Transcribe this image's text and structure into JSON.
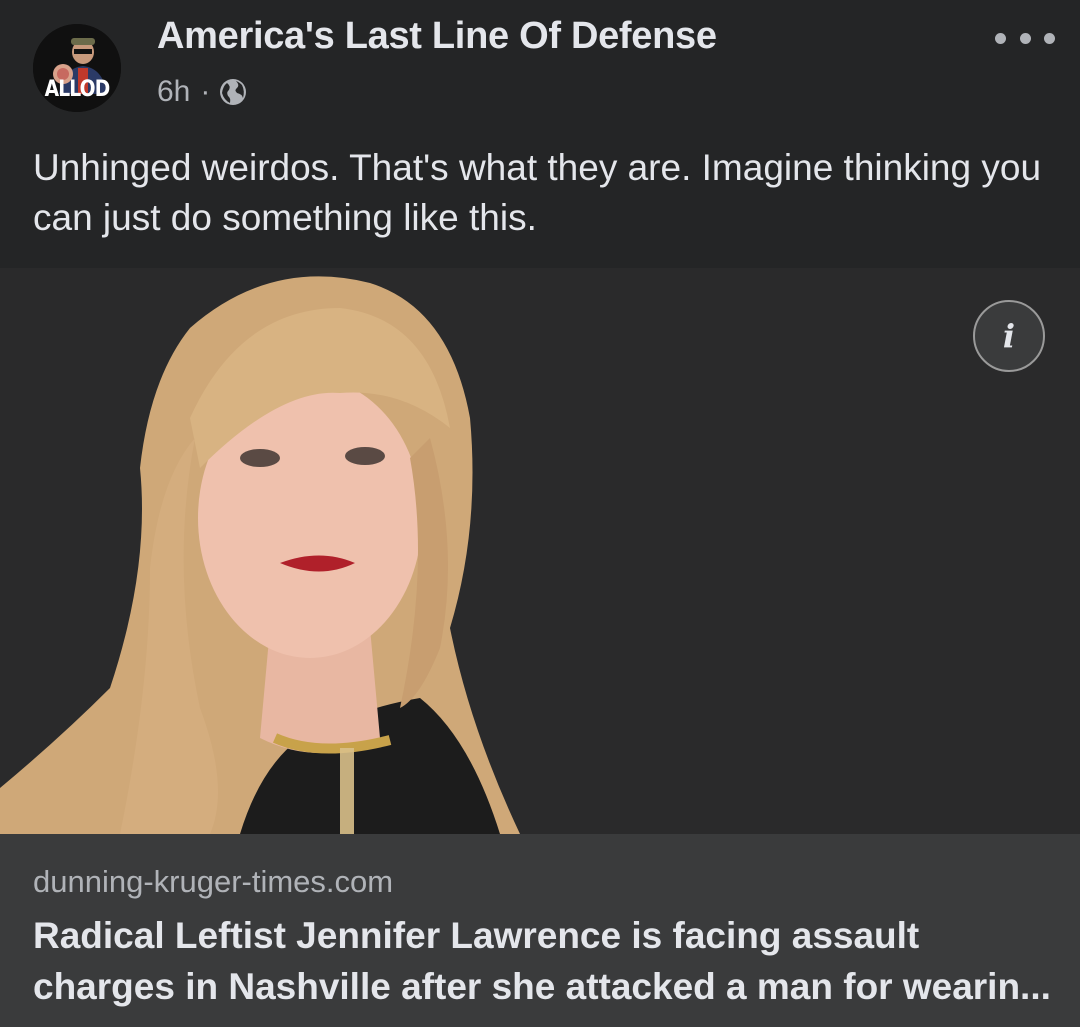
{
  "post": {
    "page_name": "America's Last Line Of Defense",
    "avatar_text": "ALLOD",
    "time": "6h",
    "separator": "·",
    "audience_icon": "globe-icon",
    "more_icon": "more-options-icon",
    "caption": "Unhinged weirdos. That's what they are. Imagine thinking you can just do something like this."
  },
  "media": {
    "info_icon": "info-icon",
    "info_label": "i"
  },
  "link_preview": {
    "domain": "dunning-kruger-times.com",
    "title": "Radical Leftist Jennifer Lawrence is facing assault charges in Nashville after she attacked a man for wearin..."
  },
  "colors": {
    "background": "#242526",
    "link_background": "#3a3b3c",
    "primary_text": "#e4e6eb",
    "secondary_text": "#b0b3b8"
  }
}
